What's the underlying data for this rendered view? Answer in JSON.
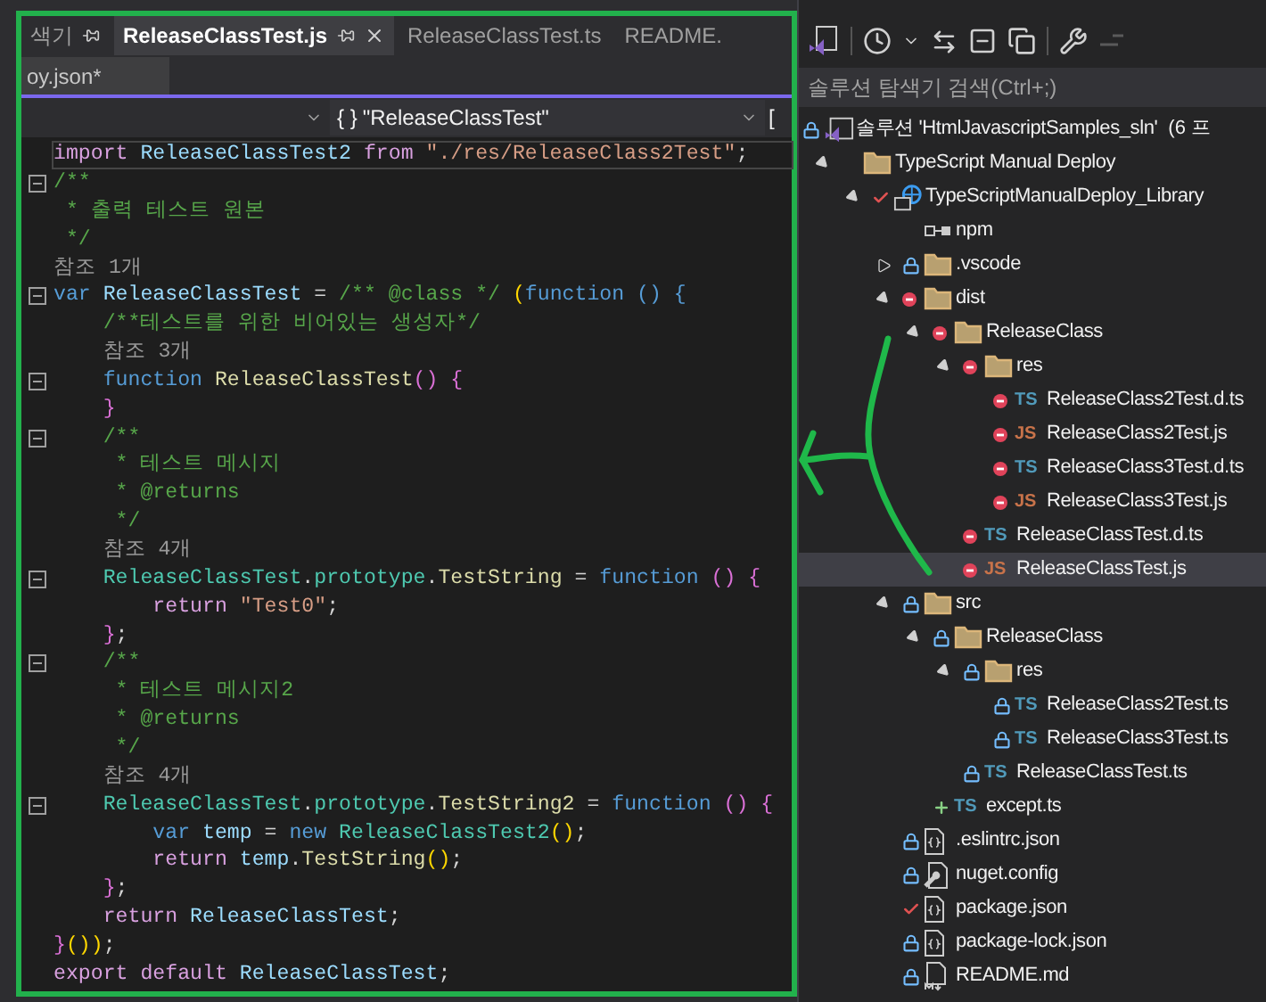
{
  "editor": {
    "tabs": [
      {
        "label": "색기",
        "selected": false,
        "pinned": true,
        "closable": false
      },
      {
        "label": "ReleaseClassTest.js",
        "selected": true,
        "pinned": true,
        "closable": true
      },
      {
        "label": "ReleaseClassTest.ts",
        "selected": false,
        "pinned": false,
        "closable": false
      },
      {
        "label": "README.",
        "selected": false,
        "pinned": false,
        "closable": false
      }
    ],
    "second_row_tabs": [
      {
        "label": "oy.json*",
        "selected": false
      }
    ],
    "nav": {
      "scope_icon": "{ }",
      "scope": "\"ReleaseClassTest\"",
      "member": "["
    },
    "lines": [
      {
        "kind": "code",
        "fold": false,
        "current": true,
        "tokens": [
          {
            "t": "import",
            "kind": "control"
          },
          {
            "t": " ReleaseClassTest2",
            "kind": "variable"
          },
          {
            "t": " from",
            "kind": "control"
          },
          {
            "t": " \"./res/ReleaseClass2Test\"",
            "kind": "string"
          },
          {
            "t": ";",
            "kind": "punct"
          }
        ]
      },
      {
        "kind": "code",
        "fold": true,
        "current": false,
        "tokens": [
          {
            "t": "/**",
            "kind": "comment"
          }
        ]
      },
      {
        "kind": "code",
        "fold": false,
        "current": false,
        "tokens": [
          {
            "t": " * 출력 테스트 원본",
            "kind": "comment"
          }
        ]
      },
      {
        "kind": "code",
        "fold": false,
        "current": false,
        "tokens": [
          {
            "t": " */",
            "kind": "comment"
          }
        ]
      },
      {
        "kind": "lens",
        "fold": false,
        "current": false,
        "text": "참조 1개"
      },
      {
        "kind": "code",
        "fold": true,
        "current": false,
        "tokens": [
          {
            "t": "var",
            "kind": "keyword"
          },
          {
            "t": " ReleaseClassTest",
            "kind": "variable"
          },
          {
            "t": " =",
            "kind": "punct"
          },
          {
            "t": " /** @class */",
            "kind": "comment"
          },
          {
            "t": " (",
            "kind": "paren"
          },
          {
            "t": "function",
            "kind": "keyword"
          },
          {
            "t": " () {",
            "kind": "keyword"
          }
        ]
      },
      {
        "kind": "code",
        "fold": false,
        "current": false,
        "tokens": [
          {
            "t": "    /**테스트를 위한 비어있는 생성자*/",
            "kind": "comment"
          }
        ]
      },
      {
        "kind": "lens",
        "fold": false,
        "current": false,
        "text": "    참조 3개"
      },
      {
        "kind": "code",
        "fold": true,
        "current": false,
        "tokens": [
          {
            "t": "    function",
            "kind": "keyword"
          },
          {
            "t": " ReleaseClassTest",
            "kind": "function"
          },
          {
            "t": "() {",
            "kind": "brace"
          }
        ]
      },
      {
        "kind": "code",
        "fold": false,
        "current": false,
        "tokens": [
          {
            "t": "    }",
            "kind": "brace"
          }
        ]
      },
      {
        "kind": "code",
        "fold": true,
        "current": false,
        "tokens": [
          {
            "t": "    /**",
            "kind": "comment"
          }
        ]
      },
      {
        "kind": "code",
        "fold": false,
        "current": false,
        "tokens": [
          {
            "t": "     * 테스트 메시지",
            "kind": "comment"
          }
        ]
      },
      {
        "kind": "code",
        "fold": false,
        "current": false,
        "tokens": [
          {
            "t": "     * @returns",
            "kind": "comment"
          }
        ]
      },
      {
        "kind": "code",
        "fold": false,
        "current": false,
        "tokens": [
          {
            "t": "     */",
            "kind": "comment"
          }
        ]
      },
      {
        "kind": "lens",
        "fold": false,
        "current": false,
        "text": "    참조 4개"
      },
      {
        "kind": "code",
        "fold": true,
        "current": false,
        "tokens": [
          {
            "t": "    ReleaseClassTest",
            "kind": "class"
          },
          {
            "t": ".",
            "kind": "punct"
          },
          {
            "t": "prototype",
            "kind": "class"
          },
          {
            "t": ".",
            "kind": "punct"
          },
          {
            "t": "TestString",
            "kind": "function"
          },
          {
            "t": " =",
            "kind": "punct"
          },
          {
            "t": " function",
            "kind": "keyword"
          },
          {
            "t": " () {",
            "kind": "brace"
          }
        ]
      },
      {
        "kind": "code",
        "fold": false,
        "current": false,
        "tokens": [
          {
            "t": "        return",
            "kind": "control"
          },
          {
            "t": " \"Test0\"",
            "kind": "string"
          },
          {
            "t": ";",
            "kind": "punct"
          }
        ]
      },
      {
        "kind": "code",
        "fold": false,
        "current": false,
        "tokens": [
          {
            "t": "    }",
            "kind": "brace"
          },
          {
            "t": ";",
            "kind": "punct"
          }
        ]
      },
      {
        "kind": "code",
        "fold": true,
        "current": false,
        "tokens": [
          {
            "t": "    /**",
            "kind": "comment"
          }
        ]
      },
      {
        "kind": "code",
        "fold": false,
        "current": false,
        "tokens": [
          {
            "t": "     * 테스트 메시지2",
            "kind": "comment"
          }
        ]
      },
      {
        "kind": "code",
        "fold": false,
        "current": false,
        "tokens": [
          {
            "t": "     * @returns",
            "kind": "comment"
          }
        ]
      },
      {
        "kind": "code",
        "fold": false,
        "current": false,
        "tokens": [
          {
            "t": "     */",
            "kind": "comment"
          }
        ]
      },
      {
        "kind": "lens",
        "fold": false,
        "current": false,
        "text": "    참조 4개"
      },
      {
        "kind": "code",
        "fold": true,
        "current": false,
        "tokens": [
          {
            "t": "    ReleaseClassTest",
            "kind": "class"
          },
          {
            "t": ".",
            "kind": "punct"
          },
          {
            "t": "prototype",
            "kind": "class"
          },
          {
            "t": ".",
            "kind": "punct"
          },
          {
            "t": "TestString2",
            "kind": "function"
          },
          {
            "t": " =",
            "kind": "punct"
          },
          {
            "t": " function",
            "kind": "keyword"
          },
          {
            "t": " () {",
            "kind": "brace"
          }
        ]
      },
      {
        "kind": "code",
        "fold": false,
        "current": false,
        "tokens": [
          {
            "t": "        var",
            "kind": "keyword"
          },
          {
            "t": " temp",
            "kind": "variable"
          },
          {
            "t": " =",
            "kind": "punct"
          },
          {
            "t": " new",
            "kind": "keyword"
          },
          {
            "t": " ReleaseClassTest2",
            "kind": "class"
          },
          {
            "t": "()",
            "kind": "paren"
          },
          {
            "t": ";",
            "kind": "punct"
          }
        ]
      },
      {
        "kind": "code",
        "fold": false,
        "current": false,
        "tokens": [
          {
            "t": "        return",
            "kind": "control"
          },
          {
            "t": " temp",
            "kind": "variable"
          },
          {
            "t": ".",
            "kind": "punct"
          },
          {
            "t": "TestString",
            "kind": "function"
          },
          {
            "t": "()",
            "kind": "paren"
          },
          {
            "t": ";",
            "kind": "punct"
          }
        ]
      },
      {
        "kind": "code",
        "fold": false,
        "current": false,
        "tokens": [
          {
            "t": "    }",
            "kind": "brace"
          },
          {
            "t": ";",
            "kind": "punct"
          }
        ]
      },
      {
        "kind": "code",
        "fold": false,
        "current": false,
        "tokens": [
          {
            "t": "    return",
            "kind": "control"
          },
          {
            "t": " ReleaseClassTest",
            "kind": "variable"
          },
          {
            "t": ";",
            "kind": "punct"
          }
        ]
      },
      {
        "kind": "code",
        "fold": false,
        "current": false,
        "tokens": [
          {
            "t": "}",
            "kind": "brace"
          },
          {
            "t": "())",
            "kind": "paren"
          },
          {
            "t": ";",
            "kind": "punct"
          }
        ]
      },
      {
        "kind": "code",
        "fold": false,
        "current": false,
        "tokens": [
          {
            "t": "export",
            "kind": "control"
          },
          {
            "t": " default",
            "kind": "control"
          },
          {
            "t": " ReleaseClassTest",
            "kind": "variable"
          },
          {
            "t": ";",
            "kind": "punct"
          }
        ]
      }
    ]
  },
  "solution_explorer": {
    "search": {
      "placeholder": "솔루션 탐색기 검색(Ctrl+;)"
    },
    "tree": [
      {
        "label": "솔루션 'HtmlJavascriptSamples_sln'",
        "suffix": "(6 프",
        "kind": "solution",
        "locked": true,
        "excluded": false,
        "checked_out": false,
        "added": false,
        "selected": false,
        "children": [
          {
            "label": "TypeScript Manual Deploy",
            "kind": "folder",
            "locked": false,
            "excluded": false,
            "checked_out": false,
            "added": false,
            "expanded": true,
            "selected": false,
            "children": [
              {
                "label": "TypeScriptManualDeploy_Library",
                "kind": "project",
                "locked": false,
                "excluded": false,
                "checked_out": true,
                "added": false,
                "expanded": true,
                "selected": false,
                "children": [
                  {
                    "label": "npm",
                    "kind": "npm",
                    "locked": false,
                    "excluded": false,
                    "checked_out": false,
                    "added": false,
                    "selected": false
                  },
                  {
                    "label": ".vscode",
                    "kind": "folder",
                    "locked": true,
                    "excluded": false,
                    "checked_out": false,
                    "added": false,
                    "expanded": false,
                    "selected": false
                  },
                  {
                    "label": "dist",
                    "kind": "folder",
                    "locked": false,
                    "excluded": true,
                    "checked_out": false,
                    "added": false,
                    "expanded": true,
                    "selected": false,
                    "children": [
                      {
                        "label": "ReleaseClass",
                        "kind": "folder",
                        "locked": false,
                        "excluded": true,
                        "checked_out": false,
                        "added": false,
                        "expanded": true,
                        "selected": false,
                        "children": [
                          {
                            "label": "res",
                            "kind": "folder",
                            "locked": false,
                            "excluded": true,
                            "checked_out": false,
                            "added": false,
                            "expanded": true,
                            "selected": false,
                            "children": [
                              {
                                "label": "ReleaseClass2Test.d.ts",
                                "kind": "ts",
                                "icon_text": "TS",
                                "locked": false,
                                "excluded": true,
                                "checked_out": false,
                                "added": false,
                                "selected": false
                              },
                              {
                                "label": "ReleaseClass2Test.js",
                                "kind": "js",
                                "icon_text": "JS",
                                "locked": false,
                                "excluded": true,
                                "checked_out": false,
                                "added": false,
                                "selected": false
                              },
                              {
                                "label": "ReleaseClass3Test.d.ts",
                                "kind": "ts",
                                "icon_text": "TS",
                                "locked": false,
                                "excluded": true,
                                "checked_out": false,
                                "added": false,
                                "selected": false
                              },
                              {
                                "label": "ReleaseClass3Test.js",
                                "kind": "js",
                                "icon_text": "JS",
                                "locked": false,
                                "excluded": true,
                                "checked_out": false,
                                "added": false,
                                "selected": false
                              }
                            ]
                          },
                          {
                            "label": "ReleaseClassTest.d.ts",
                            "kind": "ts",
                            "icon_text": "TS",
                            "locked": false,
                            "excluded": true,
                            "checked_out": false,
                            "added": false,
                            "selected": false
                          },
                          {
                            "label": "ReleaseClassTest.js",
                            "kind": "js",
                            "icon_text": "JS",
                            "locked": false,
                            "excluded": true,
                            "checked_out": false,
                            "added": false,
                            "selected": true
                          }
                        ]
                      }
                    ]
                  },
                  {
                    "label": "src",
                    "kind": "folder",
                    "locked": true,
                    "excluded": false,
                    "checked_out": false,
                    "added": false,
                    "expanded": true,
                    "selected": false,
                    "children": [
                      {
                        "label": "ReleaseClass",
                        "kind": "folder",
                        "locked": true,
                        "excluded": false,
                        "checked_out": false,
                        "added": false,
                        "expanded": true,
                        "selected": false,
                        "children": [
                          {
                            "label": "res",
                            "kind": "folder",
                            "locked": true,
                            "excluded": false,
                            "checked_out": false,
                            "added": false,
                            "expanded": true,
                            "selected": false,
                            "children": [
                              {
                                "label": "ReleaseClass2Test.ts",
                                "kind": "ts",
                                "icon_text": "TS",
                                "locked": true,
                                "excluded": false,
                                "checked_out": false,
                                "added": false,
                                "selected": false
                              },
                              {
                                "label": "ReleaseClass3Test.ts",
                                "kind": "ts",
                                "icon_text": "TS",
                                "locked": true,
                                "excluded": false,
                                "checked_out": false,
                                "added": false,
                                "selected": false
                              }
                            ]
                          },
                          {
                            "label": "ReleaseClassTest.ts",
                            "kind": "ts",
                            "icon_text": "TS",
                            "locked": true,
                            "excluded": false,
                            "checked_out": false,
                            "added": false,
                            "selected": false
                          }
                        ]
                      },
                      {
                        "label": "except.ts",
                        "kind": "ts",
                        "icon_text": "TS",
                        "locked": false,
                        "excluded": false,
                        "checked_out": false,
                        "added": true,
                        "selected": false
                      }
                    ]
                  },
                  {
                    "label": ".eslintrc.json",
                    "kind": "json",
                    "locked": true,
                    "excluded": false,
                    "checked_out": false,
                    "added": false,
                    "selected": false
                  },
                  {
                    "label": "nuget.config",
                    "kind": "config",
                    "locked": true,
                    "excluded": false,
                    "checked_out": false,
                    "added": false,
                    "selected": false
                  },
                  {
                    "label": "package.json",
                    "kind": "json",
                    "locked": false,
                    "excluded": false,
                    "checked_out": true,
                    "added": false,
                    "selected": false
                  },
                  {
                    "label": "package-lock.json",
                    "kind": "json",
                    "locked": true,
                    "excluded": false,
                    "checked_out": false,
                    "added": false,
                    "selected": false
                  },
                  {
                    "label": "README.md",
                    "kind": "md",
                    "locked": true,
                    "excluded": false,
                    "checked_out": false,
                    "added": false,
                    "selected": false
                  }
                ]
              }
            ]
          }
        ]
      }
    ]
  }
}
